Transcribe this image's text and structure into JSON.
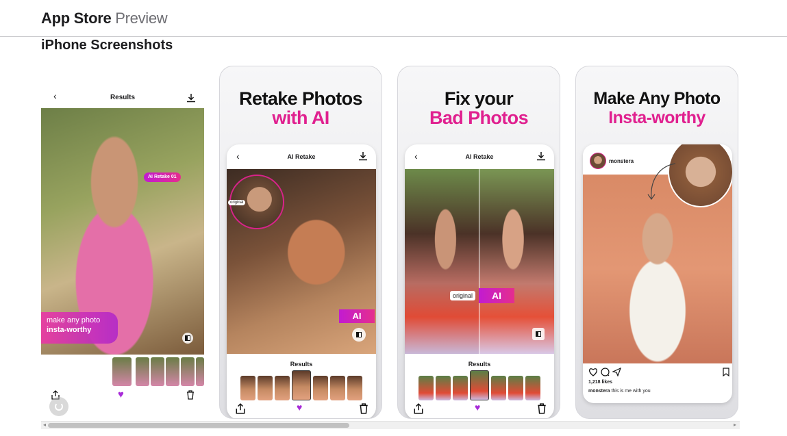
{
  "header": {
    "brand_main": "App Store",
    "brand_sub": "Preview"
  },
  "section": {
    "title": "iPhone Screenshots"
  },
  "screens": [
    {
      "header_title": "Results",
      "badge": "AI Retake 01",
      "promo_line1": "make any photo",
      "promo_line2": "insta-worthy"
    },
    {
      "headline1": "Retake Photos",
      "headline2": "with AI",
      "header_title": "AI Retake",
      "original_label": "original",
      "ai_label": "AI",
      "results_label": "Results"
    },
    {
      "headline1": "Fix your",
      "headline2": "Bad Photos",
      "header_title": "AI Retake",
      "original_label": "original",
      "ai_label": "AI",
      "results_label": "Results"
    },
    {
      "headline1": "Make Any Photo",
      "headline2": "Insta-worthy",
      "username": "monstera",
      "likes": "1,218 likes",
      "caption_user": "monstera",
      "caption_text": "this is me with you"
    }
  ],
  "colors": {
    "accent_pink": "#e0208f",
    "accent_purple": "#c21bd1"
  },
  "icons": [
    "back-arrow-icon",
    "download-icon",
    "compare-icon",
    "share-icon",
    "heart-icon",
    "trash-icon",
    "comment-icon",
    "send-icon",
    "bookmark-icon",
    "loading-spinner-icon"
  ]
}
